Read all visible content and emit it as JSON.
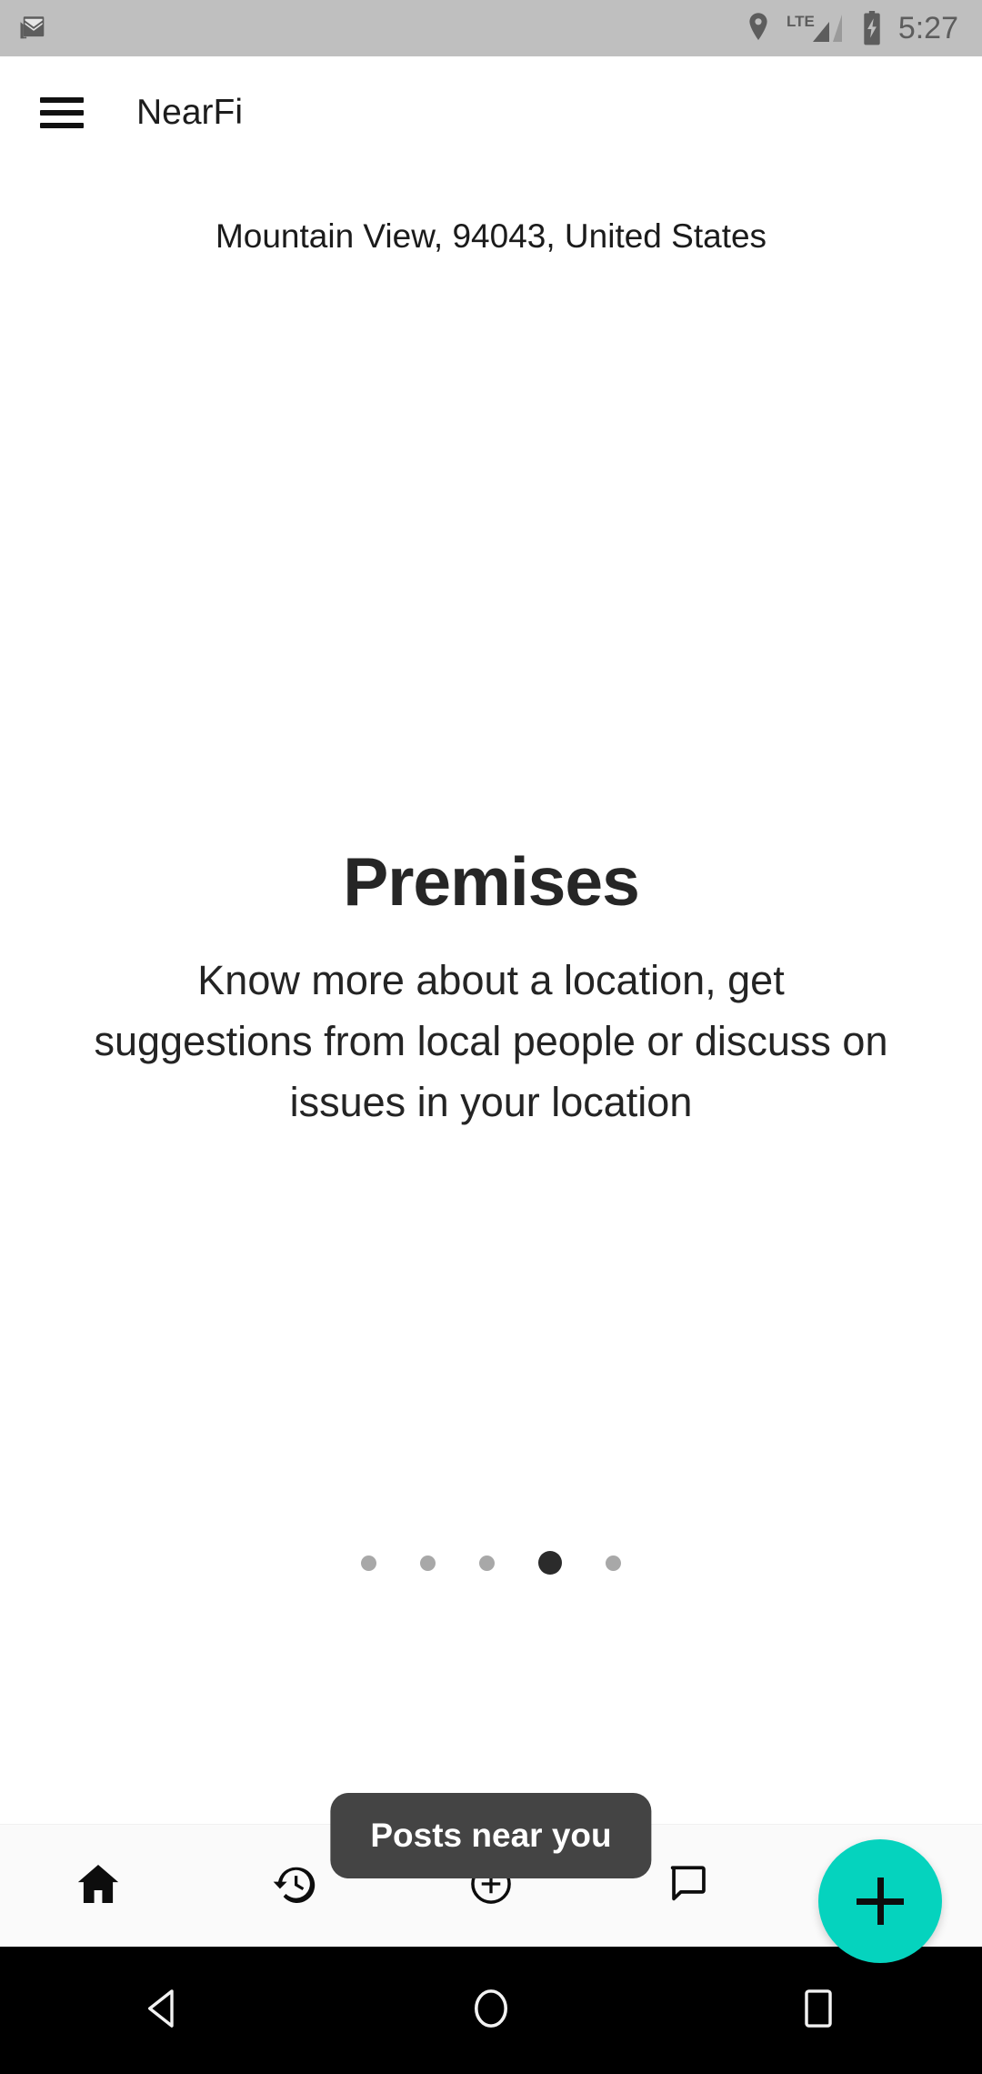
{
  "status_bar": {
    "background": "#bfbfbf",
    "notification_icon": "gmail-icon",
    "icons": [
      "location-pin-icon",
      "lte-signal-icon",
      "battery-charging-icon"
    ],
    "lte_label": "LTE",
    "clock": "5:27"
  },
  "app_bar": {
    "menu_icon": "hamburger-menu-icon",
    "title": "NearFi"
  },
  "main": {
    "location": "Mountain View, 94043, United States",
    "carousel": {
      "heading": "Premises",
      "description": "Know more about a location, get suggestions from local people or discuss on issues in your location",
      "total_pages": 5,
      "active_page": 4
    },
    "posts_button_label": "Posts near you",
    "fab": {
      "icon": "plus-icon",
      "color": "#05d3be"
    }
  },
  "bottom_nav": {
    "background": "#fafafa",
    "items": [
      {
        "name": "home",
        "icon": "home-icon",
        "active": true
      },
      {
        "name": "history",
        "icon": "history-clock-icon",
        "active": false
      },
      {
        "name": "add",
        "icon": "add-circle-outline-icon",
        "active": false
      },
      {
        "name": "chat",
        "icon": "chat-bubble-outline-icon",
        "active": false
      },
      {
        "name": "nearby",
        "icon": "send-navigate-icon",
        "active": false
      }
    ]
  },
  "android_nav": {
    "background": "#000000",
    "items": [
      {
        "name": "back",
        "icon": "back-triangle-icon"
      },
      {
        "name": "home",
        "icon": "home-circle-icon"
      },
      {
        "name": "recents",
        "icon": "recents-square-icon"
      }
    ]
  }
}
